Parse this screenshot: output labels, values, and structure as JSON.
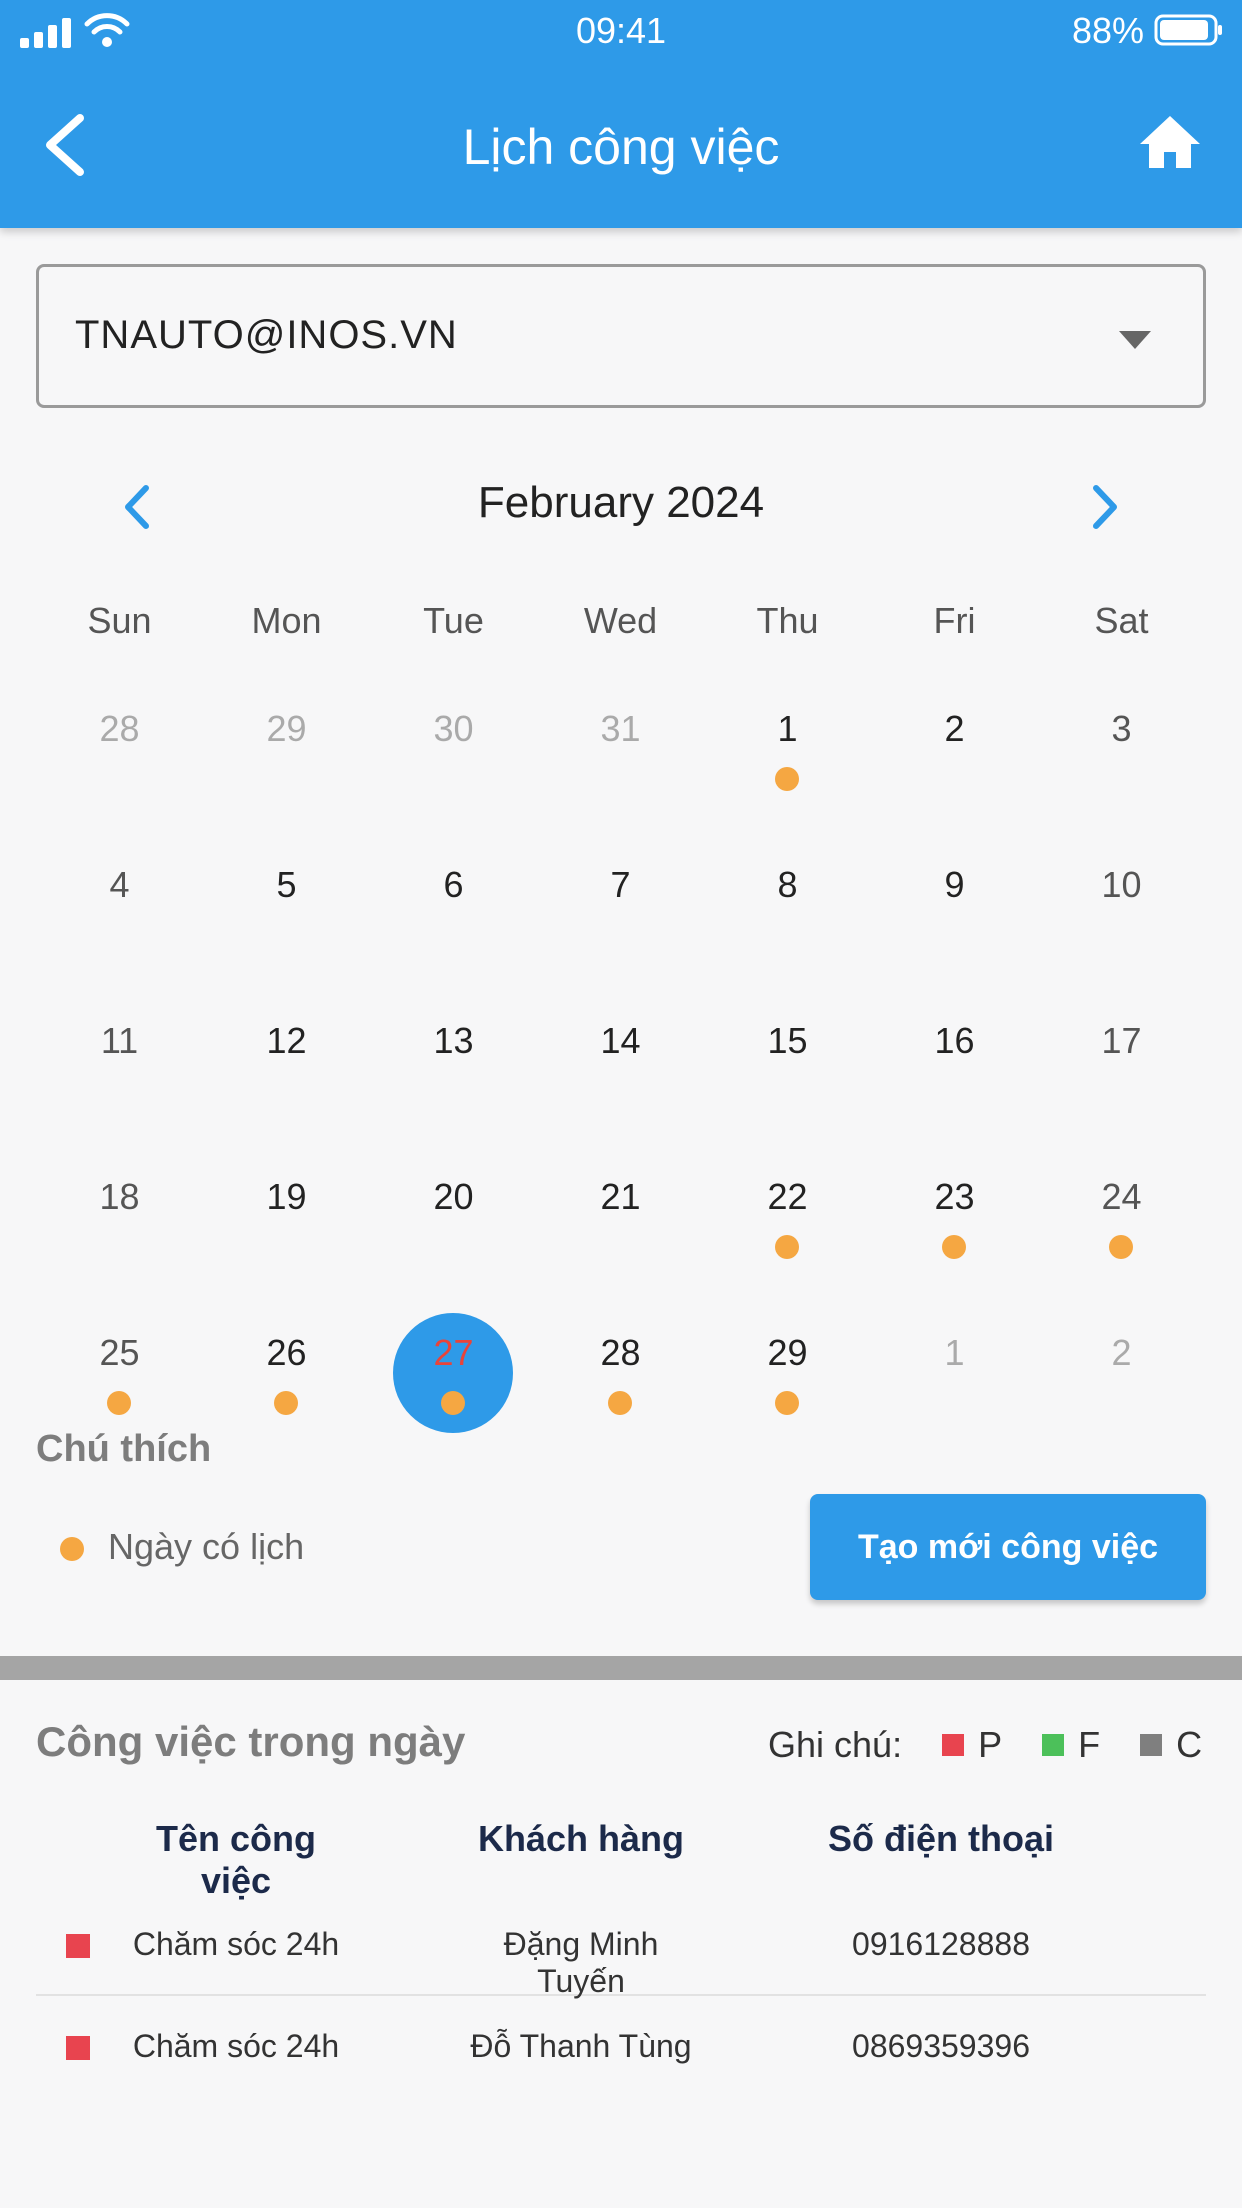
{
  "status_bar": {
    "time": "09:41",
    "battery": "88%"
  },
  "app_bar": {
    "title": "Lịch công việc"
  },
  "account": {
    "value": "TNAUTO@INOS.VN"
  },
  "calendar": {
    "month_label": "February 2024",
    "weekdays": [
      "Sun",
      "Mon",
      "Tue",
      "Wed",
      "Thu",
      "Fri",
      "Sat"
    ],
    "weeks": [
      [
        {
          "d": "28",
          "other": true
        },
        {
          "d": "29",
          "other": true
        },
        {
          "d": "30",
          "other": true
        },
        {
          "d": "31",
          "other": true
        },
        {
          "d": "1",
          "dot": true
        },
        {
          "d": "2"
        },
        {
          "d": "3"
        }
      ],
      [
        {
          "d": "4"
        },
        {
          "d": "5"
        },
        {
          "d": "6"
        },
        {
          "d": "7"
        },
        {
          "d": "8"
        },
        {
          "d": "9"
        },
        {
          "d": "10"
        }
      ],
      [
        {
          "d": "11"
        },
        {
          "d": "12"
        },
        {
          "d": "13"
        },
        {
          "d": "14"
        },
        {
          "d": "15"
        },
        {
          "d": "16"
        },
        {
          "d": "17"
        }
      ],
      [
        {
          "d": "18"
        },
        {
          "d": "19"
        },
        {
          "d": "20"
        },
        {
          "d": "21"
        },
        {
          "d": "22",
          "dot": true
        },
        {
          "d": "23",
          "dot": true
        },
        {
          "d": "24",
          "dot": true
        }
      ],
      [
        {
          "d": "25",
          "dot": true
        },
        {
          "d": "26",
          "dot": true
        },
        {
          "d": "27",
          "dot": true,
          "selected": true
        },
        {
          "d": "28",
          "dot": true
        },
        {
          "d": "29",
          "dot": true
        },
        {
          "d": "1",
          "other": true
        },
        {
          "d": "2",
          "other": true
        }
      ]
    ],
    "colors": {
      "accent": "#2e9ae8",
      "dot": "#f5a742",
      "selected_text": "#e8443a"
    }
  },
  "legend": {
    "title": "Chú thích",
    "item": "Ngày có lịch"
  },
  "create_button": {
    "label": "Tạo mới công việc"
  },
  "tasks": {
    "title": "Công việc trong ngày",
    "note_label": "Ghi chú:",
    "statuses": [
      {
        "label": "P",
        "color": "#e8444f"
      },
      {
        "label": "F",
        "color": "#4cc05a"
      },
      {
        "label": "C",
        "color": "#7f7f7f"
      }
    ],
    "columns": [
      "Tên công việc",
      "Khách hàng",
      "Số điện thoại"
    ],
    "rows": [
      {
        "name": "Chăm sóc 24h",
        "customer": "Đặng Minh Tuyến",
        "phone": "0916128888",
        "status_color": "#e8444f"
      },
      {
        "name": "Chăm sóc 24h",
        "customer": "Đỗ Thanh Tùng",
        "phone": "0869359396",
        "status_color": "#e8444f"
      }
    ]
  }
}
